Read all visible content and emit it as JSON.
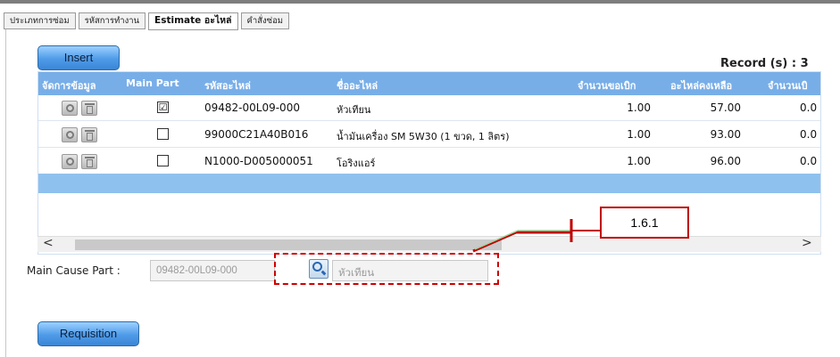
{
  "tabs": [
    {
      "label": "ประเภทการซ่อม",
      "active": false
    },
    {
      "label": "รหัสการทำงาน",
      "active": false
    },
    {
      "label": "Estimate อะไหล่",
      "active": true
    },
    {
      "label": "คำสั่งซ่อม",
      "active": false
    }
  ],
  "toolbar": {
    "insert_label": "Insert",
    "record_text": "Record (s) : 3"
  },
  "grid": {
    "headers": [
      "จัดการข้อมูล",
      "Main Part",
      "รหัสอะไหล่",
      "ชื่ออะไหล่",
      "จำนวนขอเบิก",
      "อะไหล่คงเหลือ",
      "จำนวนเบิ"
    ],
    "rows": [
      {
        "main_part_checked": true,
        "main_part_mark": "☑",
        "code": "09482-00L09-000",
        "name": "หัวเทียน",
        "qty": "1.00",
        "remaining": "57.00",
        "issued": "0.0"
      },
      {
        "main_part_checked": false,
        "main_part_mark": "",
        "code": "99000C21A40B016",
        "name": "น้ำมันเครื่อง SM 5W30 (1 ขวด, 1 ลิตร)",
        "qty": "1.00",
        "remaining": "93.00",
        "issued": "0.0"
      },
      {
        "main_part_checked": false,
        "main_part_mark": "",
        "code": "N1000-D005000051",
        "name": "โอริงแอร์",
        "qty": "1.00",
        "remaining": "96.00",
        "issued": "0.0"
      }
    ]
  },
  "scroll": {
    "left_arrow": "<",
    "right_arrow": ">"
  },
  "callout": {
    "label": "1.6.1"
  },
  "main_cause": {
    "label": "Main Cause Part :",
    "code_value": "09482-00L09-000",
    "name_value": "หัวเทียน"
  },
  "requisition": {
    "label": "Requisition"
  },
  "colors": {
    "header_bg": "#78aee8",
    "button_bg": "#4f9be8",
    "callout_red": "#c00000"
  },
  "icons": {
    "edit": "gear-icon",
    "delete": "trash-icon",
    "search": "search-icon"
  }
}
